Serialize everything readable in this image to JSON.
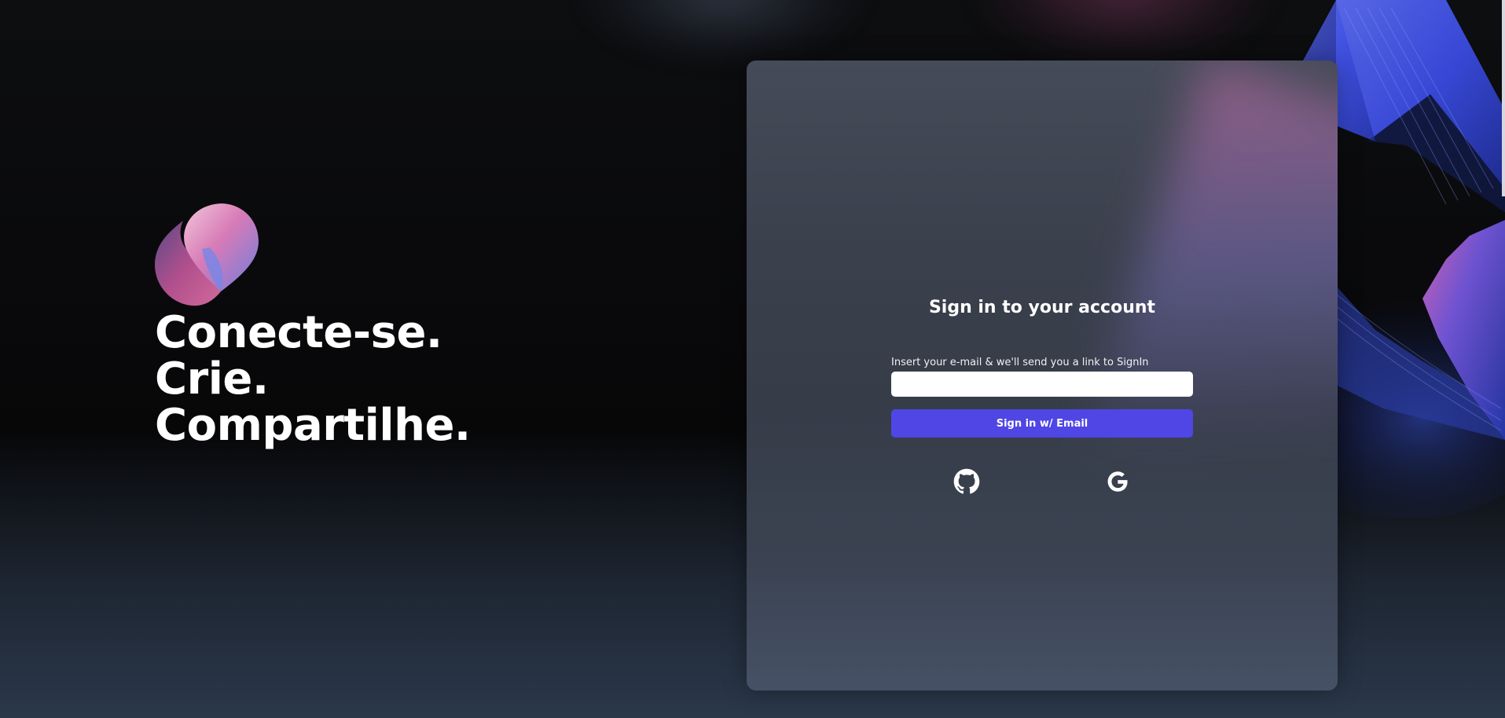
{
  "hero": {
    "lines": [
      "Conecte-se.",
      "Crie.",
      "Compartilhe."
    ],
    "logo_icon": "droplet-logo-icon"
  },
  "card": {
    "title": "Sign in to your account",
    "email_label": "Insert your e-mail & we'll send you a link to SignIn",
    "email_value": "",
    "email_placeholder": "",
    "submit_label": "Sign in w/ Email",
    "providers": [
      {
        "name": "github",
        "icon": "github-icon"
      },
      {
        "name": "google",
        "icon": "google-icon"
      }
    ]
  },
  "colors": {
    "accent": "#4f46e5",
    "background": "#09090b",
    "card": "#3a404c",
    "text": "#ffffff"
  }
}
